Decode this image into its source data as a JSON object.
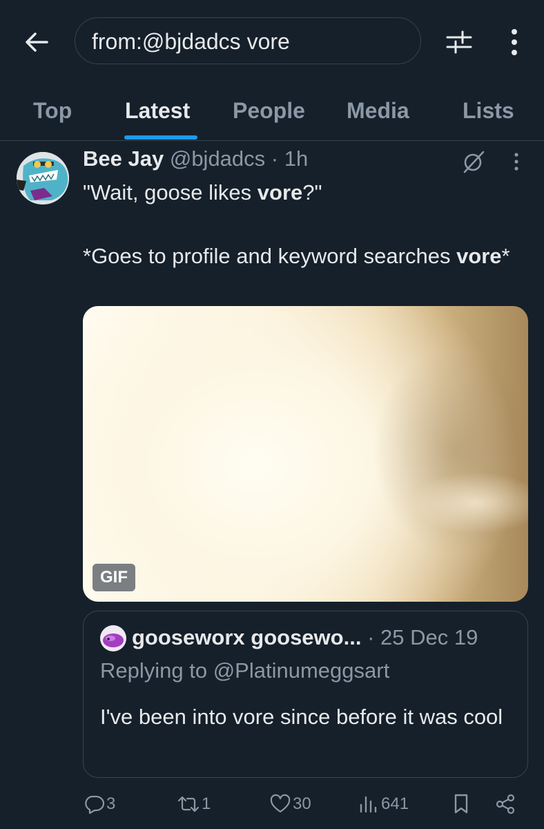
{
  "search": {
    "query": "from:@bjdadcs vore"
  },
  "icons": {
    "back": "arrow-left-icon",
    "filter": "sliders-icon",
    "more": "more-vertical-icon",
    "grok": "grok-icon",
    "reply": "reply-icon",
    "retweet": "retweet-icon",
    "like": "heart-icon",
    "views": "views-icon",
    "bookmark": "bookmark-icon",
    "share": "share-icon"
  },
  "tabs": [
    {
      "label": "Top",
      "active": false
    },
    {
      "label": "Latest",
      "active": true
    },
    {
      "label": "People",
      "active": false
    },
    {
      "label": "Media",
      "active": false
    },
    {
      "label": "Lists",
      "active": false
    }
  ],
  "post": {
    "author_name": "Bee Jay",
    "author_meta": "@bjdadcs · 1h",
    "text_parts": [
      "\"Wait, goose likes ",
      "vore",
      "?\"",
      "*Goes to profile and keyword searches ",
      "vore",
      "*"
    ],
    "media_badge": "GIF",
    "quote": {
      "author_name": "gooseworx goosewo...",
      "meta": "· 25 Dec 19",
      "replying_to": "Replying to @Platinumeggsart",
      "text": "I've been into vore since before it was cool"
    },
    "stats": {
      "replies": "3",
      "retweets": "1",
      "likes": "30",
      "views": "641"
    }
  },
  "colors": {
    "background": "#15202b",
    "accent": "#1d9bf0",
    "text_primary": "#e7e9ea",
    "text_secondary": "#8b98a5",
    "border": "#38444d"
  }
}
